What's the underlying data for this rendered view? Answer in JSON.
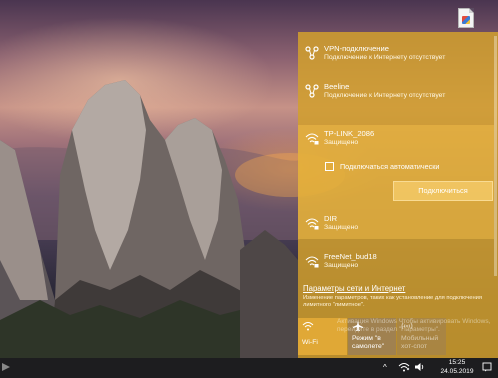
{
  "networks": [
    {
      "name": "VPN-подключение",
      "status": "Подключение к Интернету отсутствует",
      "icon": "vpn-icon"
    },
    {
      "name": "Beeline",
      "status": "Подключение к Интернету отсутствует",
      "icon": "vpn-icon"
    },
    {
      "name": "TP-LINK_2086",
      "status": "Защищено",
      "icon": "wifi-secured-icon"
    },
    {
      "name": "DIR",
      "status": "Защищено",
      "icon": "wifi-secured-icon"
    },
    {
      "name": "FreeNet_bud18",
      "status": "Защищено",
      "icon": "wifi-secured-icon"
    }
  ],
  "selected_network": {
    "auto_connect_label": "Подключаться автоматически",
    "auto_connect_checked": false,
    "connect_button": "Подключиться"
  },
  "settings": {
    "link": "Параметры сети и Интернет",
    "description": "Изменение параметров, таких как установление для подключения лимитного \"лимитное\"."
  },
  "tiles": [
    {
      "label": "Wi-Fi",
      "state": "on",
      "icon": "wifi-icon"
    },
    {
      "label": "Режим \"в самолете\"",
      "state": "off",
      "icon": "airplane-icon"
    },
    {
      "label": "Мобильный хот-спот",
      "state": "disabled",
      "icon": "hotspot-icon"
    }
  ],
  "watermark": "Активация Windows Чтобы активировать Windows, перейдите в раздел \"Параметры\".",
  "taskbar": {
    "time": "15:25",
    "date": "24.05.2019",
    "chevron": "^"
  },
  "colors": {
    "accent": "#d2a02d",
    "taskbar": "#1d1d1f"
  }
}
